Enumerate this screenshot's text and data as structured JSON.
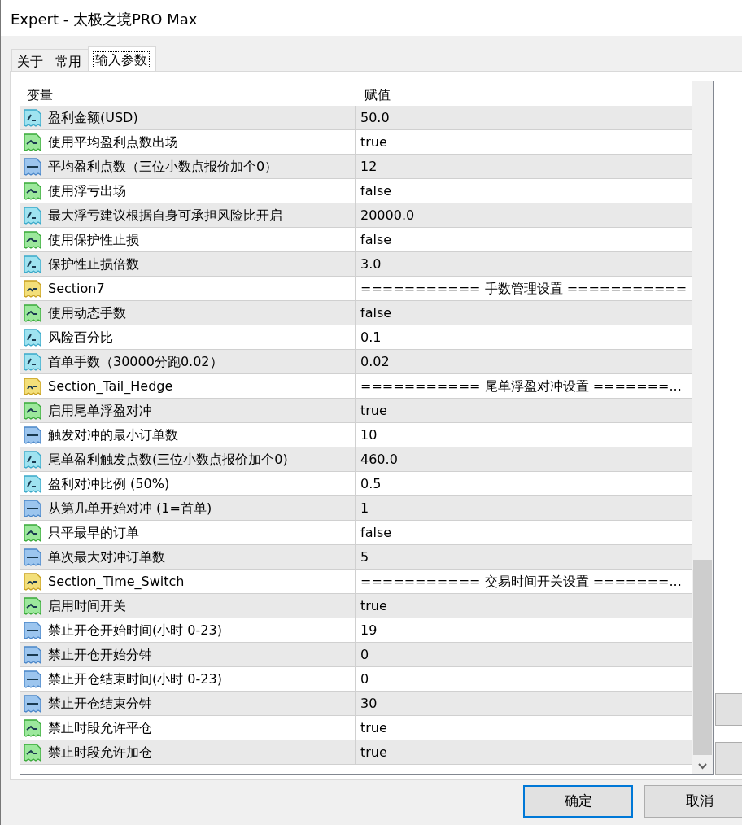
{
  "window": {
    "title": "Expert - 太极之境PRO  Max"
  },
  "tabs": [
    {
      "label": "关于",
      "selected": false
    },
    {
      "label": "常用",
      "selected": false
    },
    {
      "label": "输入参数",
      "selected": true
    }
  ],
  "table": {
    "columns": [
      "变量",
      "赋值"
    ],
    "rows": [
      {
        "kind": "double",
        "name": "盈利金额(USD)",
        "value": "50.0"
      },
      {
        "kind": "bool",
        "name": "使用平均盈利点数出场",
        "value": "true"
      },
      {
        "kind": "int",
        "name": "平均盈利点数（三位小数点报价加个0）",
        "value": "12"
      },
      {
        "kind": "bool",
        "name": "使用浮亏出场",
        "value": "false"
      },
      {
        "kind": "double",
        "name": "最大浮亏建议根据自身可承担风险比开启",
        "value": "20000.0"
      },
      {
        "kind": "bool",
        "name": "使用保护性止损",
        "value": "false"
      },
      {
        "kind": "double",
        "name": "保护性止损倍数",
        "value": "3.0"
      },
      {
        "kind": "string",
        "name": "Section7",
        "value": "=========== 手数管理设置 ==========="
      },
      {
        "kind": "bool",
        "name": "使用动态手数",
        "value": "false"
      },
      {
        "kind": "double",
        "name": "风险百分比",
        "value": "0.1"
      },
      {
        "kind": "double",
        "name": "首单手数（30000分跑0.02）",
        "value": "0.02"
      },
      {
        "kind": "string",
        "name": "Section_Tail_Hedge",
        "value": "=========== 尾单浮盈对冲设置 =======..."
      },
      {
        "kind": "bool",
        "name": "启用尾单浮盈对冲",
        "value": "true"
      },
      {
        "kind": "int",
        "name": "触发对冲的最小订单数",
        "value": "10"
      },
      {
        "kind": "double",
        "name": "尾单盈利触发点数(三位小数点报价加个0)",
        "value": "460.0"
      },
      {
        "kind": "double",
        "name": "盈利对冲比例 (50%)",
        "value": "0.5"
      },
      {
        "kind": "int",
        "name": "从第几单开始对冲 (1=首单)",
        "value": "1"
      },
      {
        "kind": "bool",
        "name": "只平最早的订单",
        "value": "false"
      },
      {
        "kind": "int",
        "name": "单次最大对冲订单数",
        "value": "5"
      },
      {
        "kind": "string",
        "name": "Section_Time_Switch",
        "value": "=========== 交易时间开关设置 =======..."
      },
      {
        "kind": "bool",
        "name": "启用时间开关",
        "value": "true"
      },
      {
        "kind": "int",
        "name": "禁止开仓开始时间(小时 0-23)",
        "value": "19"
      },
      {
        "kind": "int",
        "name": "禁止开仓开始分钟",
        "value": "0"
      },
      {
        "kind": "int",
        "name": "禁止开仓结束时间(小时 0-23)",
        "value": "0"
      },
      {
        "kind": "int",
        "name": "禁止开仓结束分钟",
        "value": "30"
      },
      {
        "kind": "bool",
        "name": "禁止时段允许平仓",
        "value": "true"
      },
      {
        "kind": "bool",
        "name": "禁止时段允许加仓",
        "value": "true"
      }
    ]
  },
  "buttons": [
    {
      "label": "确定",
      "default": true
    },
    {
      "label": "取消",
      "default": false
    }
  ]
}
